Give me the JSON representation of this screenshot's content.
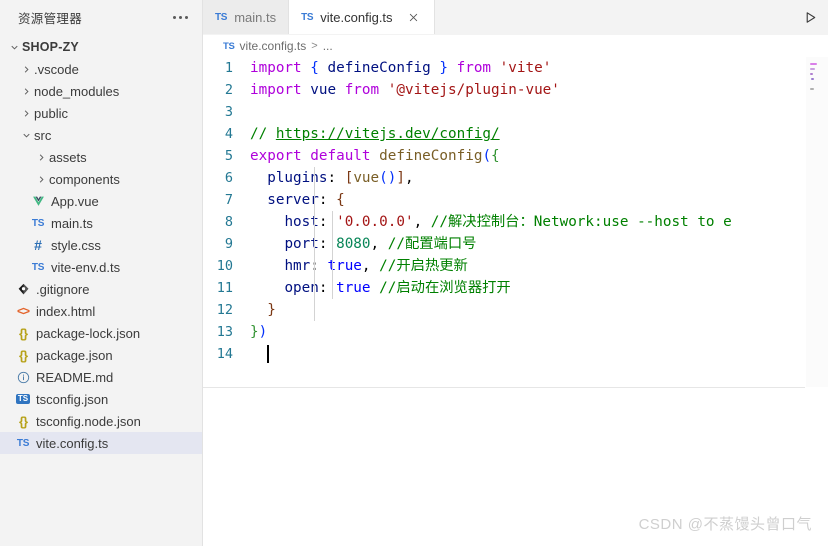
{
  "sidebar": {
    "title": "资源管理器",
    "more_icon": "ellipsis-icon",
    "root": {
      "label": "SHOP-ZY",
      "expanded": true
    },
    "items": [
      {
        "label": ".vscode",
        "kind": "folder",
        "icon": "folder-icon",
        "expanded": false,
        "indent": 1
      },
      {
        "label": "node_modules",
        "kind": "folder",
        "icon": "folder-icon",
        "expanded": false,
        "indent": 1
      },
      {
        "label": "public",
        "kind": "folder",
        "icon": "folder-icon",
        "expanded": false,
        "indent": 1
      },
      {
        "label": "src",
        "kind": "folder",
        "icon": "folder-icon",
        "expanded": true,
        "indent": 1
      },
      {
        "label": "assets",
        "kind": "folder",
        "icon": "folder-icon",
        "expanded": false,
        "indent": 2
      },
      {
        "label": "components",
        "kind": "folder",
        "icon": "folder-icon",
        "expanded": false,
        "indent": 2
      },
      {
        "label": "App.vue",
        "kind": "file",
        "icon": "vue-file-icon",
        "indent": 2
      },
      {
        "label": "main.ts",
        "kind": "file",
        "icon": "typescript-file-icon",
        "indent": 2
      },
      {
        "label": "style.css",
        "kind": "file",
        "icon": "css-file-icon",
        "indent": 2
      },
      {
        "label": "vite-env.d.ts",
        "kind": "file",
        "icon": "typescript-file-icon",
        "indent": 2
      },
      {
        "label": ".gitignore",
        "kind": "file",
        "icon": "git-file-icon",
        "indent": 1
      },
      {
        "label": "index.html",
        "kind": "file",
        "icon": "html-file-icon",
        "indent": 1
      },
      {
        "label": "package-lock.json",
        "kind": "file",
        "icon": "json-file-icon",
        "indent": 1
      },
      {
        "label": "package.json",
        "kind": "file",
        "icon": "json-file-icon",
        "indent": 1
      },
      {
        "label": "README.md",
        "kind": "file",
        "icon": "markdown-file-icon",
        "indent": 1
      },
      {
        "label": "tsconfig.json",
        "kind": "file",
        "icon": "tsconfig-file-icon",
        "indent": 1
      },
      {
        "label": "tsconfig.node.json",
        "kind": "file",
        "icon": "json-file-icon",
        "indent": 1
      },
      {
        "label": "vite.config.ts",
        "kind": "file",
        "icon": "typescript-file-icon",
        "indent": 1,
        "selected": true
      }
    ]
  },
  "tabs": [
    {
      "label": "main.ts",
      "icon": "typescript-file-icon",
      "active": false,
      "closable": false
    },
    {
      "label": "vite.config.ts",
      "icon": "typescript-file-icon",
      "active": true,
      "closable": true,
      "close_icon": "close-icon"
    }
  ],
  "toolbar": {
    "run_label": "",
    "run_icon": "run-play-icon"
  },
  "breadcrumb": {
    "file_icon": "typescript-file-icon",
    "file": "vite.config.ts",
    "separator": ">",
    "symbol": "..."
  },
  "editor": {
    "language": "TypeScript",
    "line_numbers": [
      "1",
      "2",
      "3",
      "4",
      "5",
      "6",
      "7",
      "8",
      "9",
      "10",
      "11",
      "12",
      "13",
      "14"
    ],
    "lines": [
      {
        "n": "1",
        "text": "import { defineConfig } from 'vite'"
      },
      {
        "n": "2",
        "text": "import vue from '@vitejs/plugin-vue'"
      },
      {
        "n": "3",
        "text": ""
      },
      {
        "n": "4",
        "text": "// https://vitejs.dev/config/"
      },
      {
        "n": "5",
        "text": "export default defineConfig({"
      },
      {
        "n": "6",
        "text": "  plugins: [vue()],"
      },
      {
        "n": "7",
        "text": "  server: {"
      },
      {
        "n": "8",
        "text": "    host: '0.0.0.0', //解决控制台：Network:use --host to e"
      },
      {
        "n": "9",
        "text": "    port: 8080, //配置端口号"
      },
      {
        "n": "10",
        "text": "    hmr: true, //开启热更新"
      },
      {
        "n": "11",
        "text": "    open: true //启动在浏览器打开"
      },
      {
        "n": "12",
        "text": "  }"
      },
      {
        "n": "13",
        "text": "})"
      },
      {
        "n": "14",
        "text": ""
      }
    ],
    "cursor_line": 14,
    "colors": {
      "keyword": "#af00db",
      "string": "#a31515",
      "comment": "#008000",
      "function": "#795e26",
      "property": "#001080",
      "number": "#098658",
      "boolean": "#0000ff",
      "line_number": "#237893",
      "background": "#ffffff"
    }
  },
  "watermark": {
    "text": "CSDN @不蒸馒头曾口气"
  }
}
